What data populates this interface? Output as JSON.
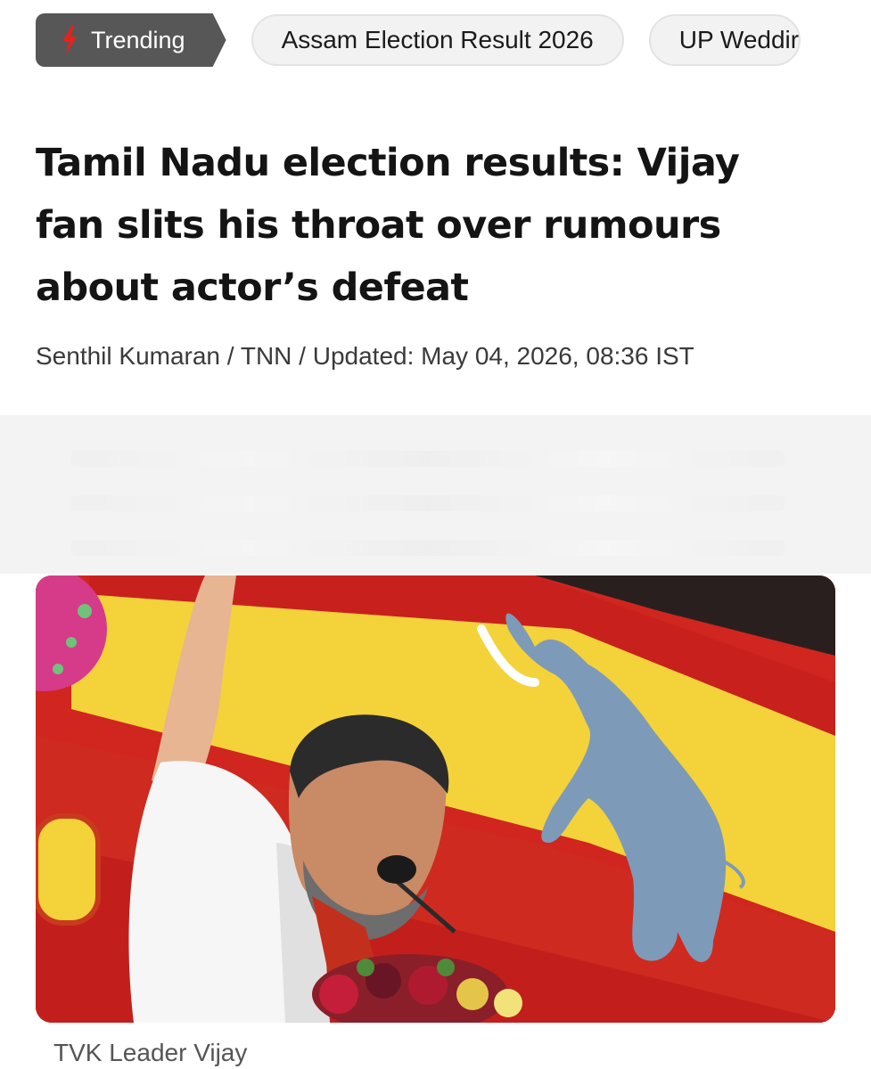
{
  "trending": {
    "label": "Trending",
    "icon": "lightning-bolt-icon",
    "accent": "#e2231a",
    "chips": [
      "Assam Election Result 2026",
      "UP Weddir"
    ]
  },
  "article": {
    "headline": "Tamil Nadu election results: Vijay fan slits his throat over rumours about actor’s defeat",
    "byline": "Senthil Kumaran / TNN / Updated: May 04, 2026, 08:36 IST",
    "image_caption": "TVK Leader Vijay"
  },
  "colors": {
    "flag_red": "#d0261f",
    "flag_yellow": "#f4d23a",
    "elephant": "#7d9bb8"
  }
}
